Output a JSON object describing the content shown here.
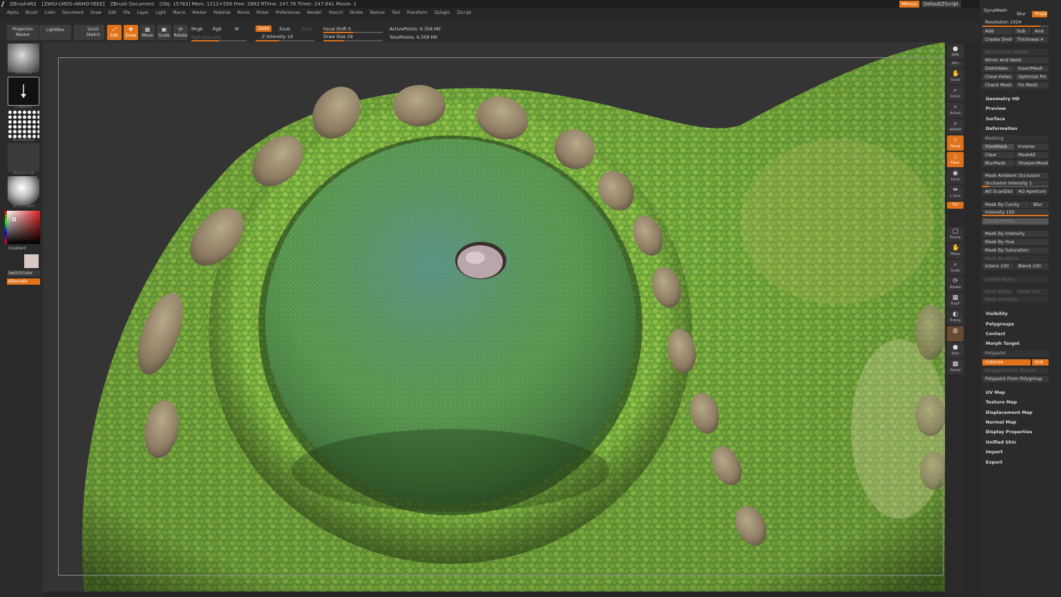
{
  "titlebar": {
    "app": "ZBrush4R2",
    "code": "[ZWIU-LMOS-AWHO-YEEE]",
    "doc": "ZBrush Document",
    "stats": "[Obj: 15783]  Mem: 1212+556  Free: 2883  RTime: 247.76  Timer: 247.641  Movie: 1",
    "menus_btn": "Menus",
    "script_btn": "DefaultZScript"
  },
  "menubar": [
    "Alpha",
    "Brush",
    "Color",
    "Document",
    "Draw",
    "Edit",
    "File",
    "Layer",
    "Light",
    "Macro",
    "Marker",
    "Material",
    "Movie",
    "Picker",
    "Preferences",
    "Render",
    "Stencil",
    "Stroke",
    "Texture",
    "Tool",
    "Transform",
    "Zplugin",
    "Zscript"
  ],
  "toolbar": {
    "projection_master": "Projection Master",
    "lightbox": "LightBox",
    "quick_sketch": "Quick Sketch",
    "edit": "Edit",
    "draw": "Draw",
    "move": "Move",
    "scale": "Scale",
    "rotate": "Rotate",
    "mrgb": "Mrgb",
    "rgb": "Rgb",
    "m": "M",
    "rgb_intensity": "Rgb Intensity",
    "zadd": "Zadd",
    "zsub": "Zsub",
    "zcut": "Zcut",
    "z_intensity": "Z Intensity 14",
    "focal_shift": "Focal Shift 0",
    "draw_size": "Draw Size 29",
    "active_points": "ActivePoints: 6.356 Mil",
    "total_points": "TotalPoints: 6.359 Mil"
  },
  "leftshelf": {
    "standard": "Standard",
    "dragrect": "DragRect",
    "brushalpha": "BrushAlpha",
    "texture_off": "Texture Off",
    "skinshade": "SkinShade4",
    "gradient": "Gradient",
    "switchcolor": "SwitchColor",
    "alternate": "Alternate"
  },
  "rightshelf": [
    "BPR",
    "SPix",
    "Scroll",
    "Zoom",
    "Actual",
    "AAHalf",
    "Persp",
    "Floor",
    "Local",
    "L.Sym",
    "Xyz",
    "Frame",
    "Move",
    "Scale",
    "Rotate",
    "PolyF",
    "Transp",
    "Ghost",
    "Solo",
    "Xpose"
  ],
  "palette": {
    "dynamesh": "DynaMesh",
    "blur": "Blur",
    "project": "Projec",
    "resolution": "Resolution 1024",
    "add": "Add",
    "sub": "Sub",
    "and": "And",
    "create_shell": "Create Shell",
    "thickness": "Thickness 4",
    "reconstruct_subdiv": "Reconstruct Subdiv",
    "mirror_and_weld": "Mirror And Weld",
    "delhidden": "DelHidden",
    "insertmesh": "InsertMesh",
    "close_holes": "Close Holes",
    "optimize_points": "Optimize Poi",
    "check_mesh": "Check Mesh",
    "fix_mesh": "Fix Mesh",
    "geometry_hd": "Geometry HD",
    "preview": "Preview",
    "surface": "Surface",
    "deformation": "Deformation",
    "masking": "Masking",
    "viewmask": "ViewMask",
    "inverse": "Inverse",
    "clear": "Clear",
    "maskall": "MaskAll",
    "blurmask": "BlurMask",
    "sharpenmask": "SharpenMask",
    "mask_ambient_occlusion": "Mask Ambient Occlusion",
    "occlusion_intensity": "Occlusion Intensity 1",
    "ao_scandist": "AO ScanDist",
    "ao_aperture": "AO Aperture",
    "mask_by_cavity": "Mask By Cavity",
    "blur2": "Blur",
    "intensity": "Intensity 100",
    "cavity_profile": "Cavity Profile",
    "mask_by_intensity": "Mask By Intensity",
    "mask_by_hue": "Mask By Hue",
    "mask_by_saturation": "Mask By Saturation",
    "mask_by_alpha": "Mask By Alpha",
    "intens": "Intens 100",
    "blend": "Blend 100",
    "create_alpha": "Create Alpha",
    "mask_alpha": "Mask Alpha",
    "mask_txtr": "Mask Txtr",
    "mask_intensity": "Mask Intensity",
    "visibility": "Visibility",
    "polygroups": "Polygroups",
    "contact": "Contact",
    "morph_target": "Morph Target",
    "polypaint": "Polypaint",
    "colorize": "Colorize",
    "grd": "Grd",
    "polypaint_from_texture": "Polypaint From Texture",
    "polypaint_from_polygroup": "Polypaint From Polygroup",
    "uv_map": "UV Map",
    "texture_map": "Texture Map",
    "displacement_map": "Displacement Map",
    "normal_map": "Normal Map",
    "display_properties": "Display Properties",
    "unified_skin": "Unified Skin",
    "import": "Import",
    "export": "Export"
  },
  "colors": {
    "accent": "#e0731a",
    "panel": "#2b2b2b",
    "button": "#3a3a3a",
    "skin_green": "#6ea43a"
  }
}
